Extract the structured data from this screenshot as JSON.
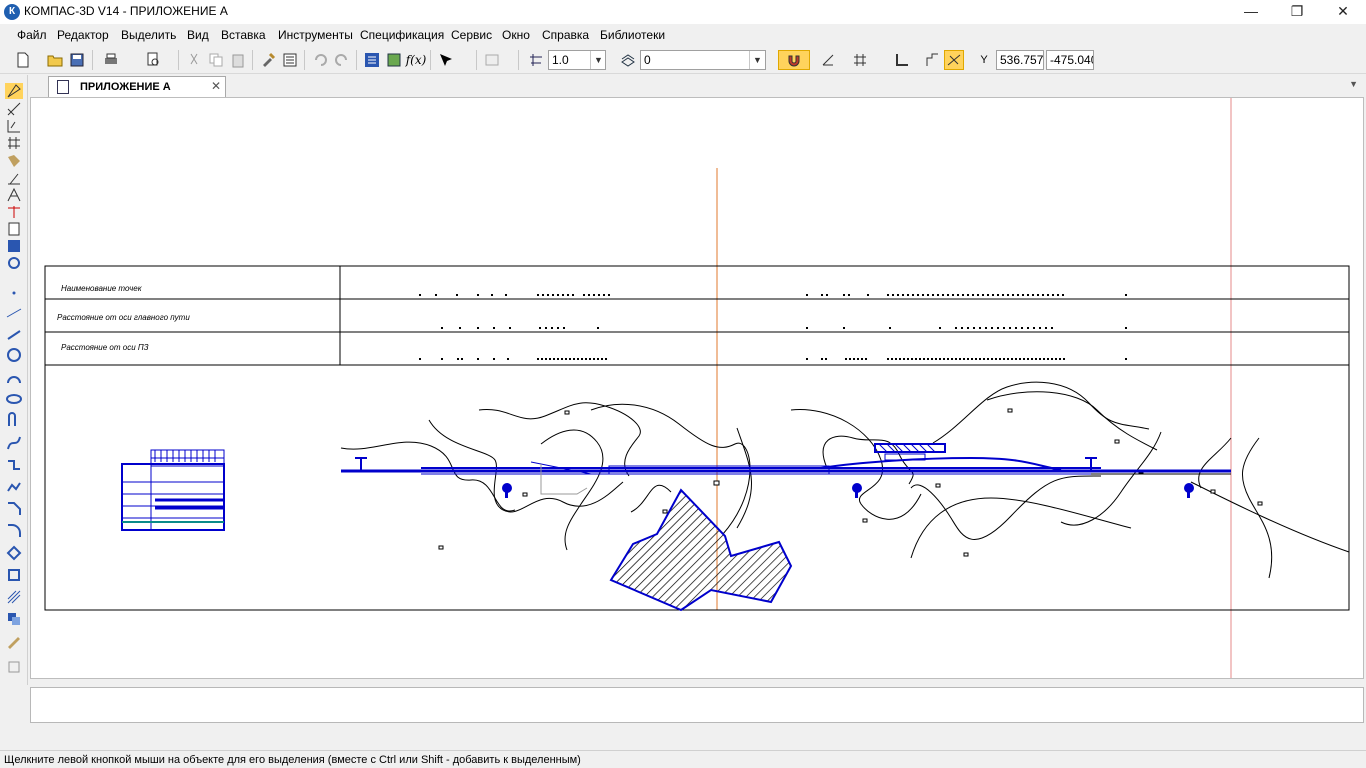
{
  "window": {
    "title": "КОМПАС-3D V14 - ПРИЛОЖЕНИЕ А",
    "app_icon": "К",
    "minimize": "—",
    "restore": "❐",
    "close": "✕"
  },
  "menu": [
    "Файл",
    "Редактор",
    "Выделить",
    "Вид",
    "Вставка",
    "Инструменты",
    "Спецификация",
    "Сервис",
    "Окно",
    "Справка",
    "Библиотеки"
  ],
  "toolbar": {
    "scale_value": "1.0",
    "layer_value": "0",
    "coord_x_label": "Y",
    "coord_x": "536.757",
    "coord_y": "-475.040",
    "fx_label": "f(x)"
  },
  "doc_tab": {
    "label": "ПРИЛОЖЕНИЕ А",
    "close": "✕"
  },
  "drawing": {
    "rows": [
      "Наименование точек",
      "Расстояние от оси главного пути",
      "Расстояние от оси ПЗ"
    ],
    "colors": {
      "line": "#000000",
      "blue": "#0000cc",
      "axis_orange": "#e07a2e",
      "frame_red": "#e58a8a"
    }
  },
  "status": {
    "text": "Щелкните левой кнопкой мыши на объекте для его выделения (вместе с Ctrl или Shift - добавить к выделенным)"
  }
}
